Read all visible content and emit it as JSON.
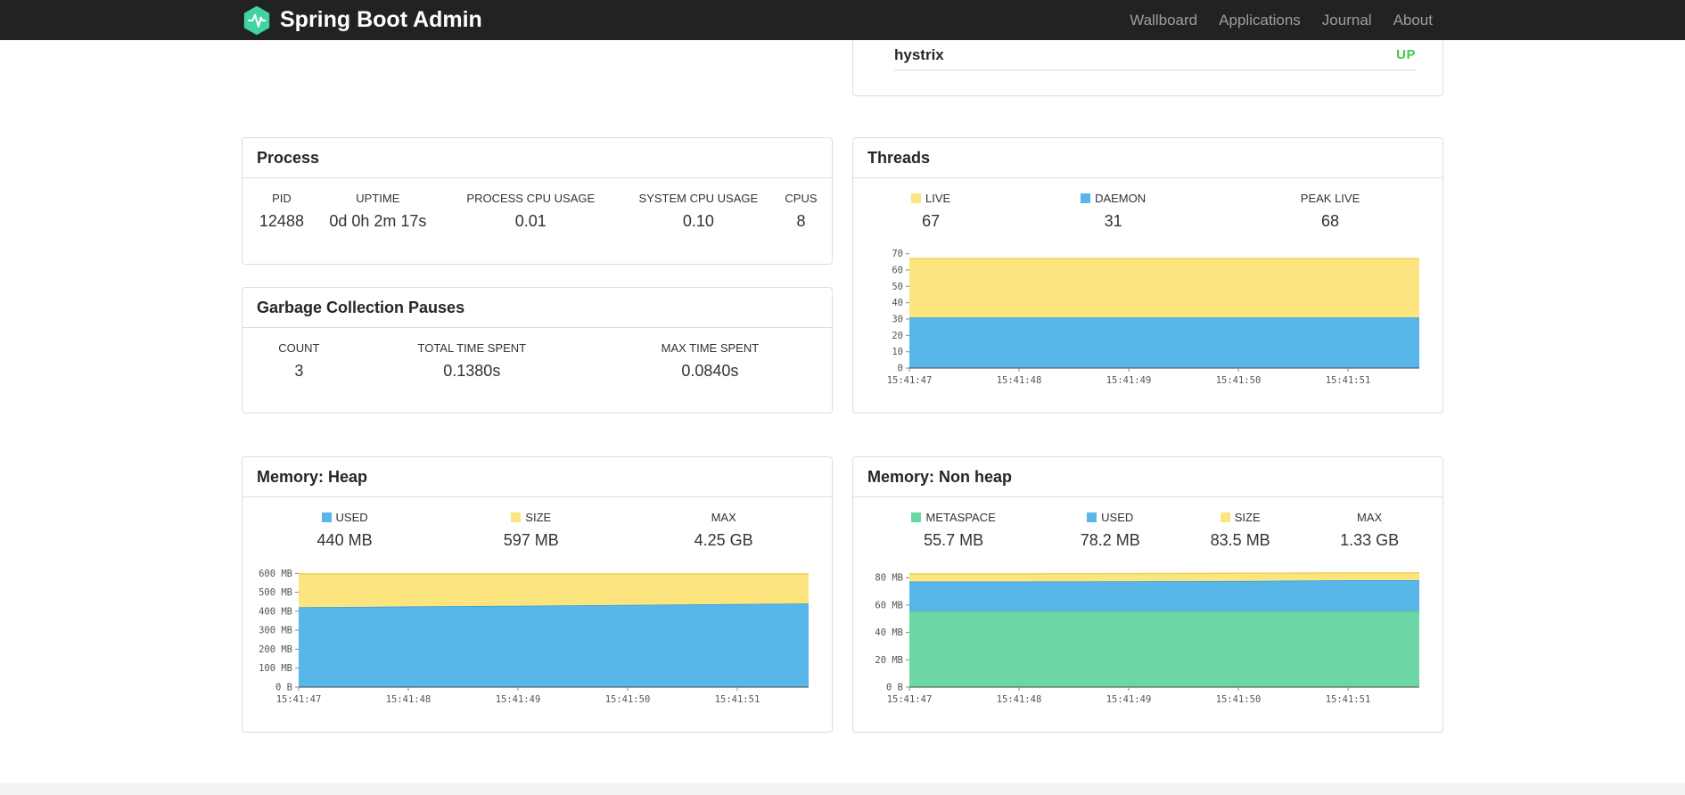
{
  "navbar": {
    "brand": "Spring Boot Admin",
    "links": [
      {
        "label": "Wallboard"
      },
      {
        "label": "Applications"
      },
      {
        "label": "Journal"
      },
      {
        "label": "About"
      }
    ]
  },
  "application_status": {
    "name": "hystrix",
    "status": "UP",
    "status_color": "#44cc44"
  },
  "colors": {
    "navbar_bg": "#222222",
    "brand_teal": "#42d3a2",
    "chart_yellow": "#fce57e",
    "chart_blue": "#58b6e9",
    "chart_green": "#6cd7a4",
    "status_up": "#44cc44",
    "panel_border": "#dddddd"
  },
  "panels": {
    "process": {
      "title": "Process",
      "stats": [
        {
          "label": "PID",
          "value": "12488"
        },
        {
          "label": "UPTIME",
          "value": "0d 0h 2m 17s"
        },
        {
          "label": "PROCESS CPU USAGE",
          "value": "0.01"
        },
        {
          "label": "SYSTEM CPU USAGE",
          "value": "0.10"
        },
        {
          "label": "CPUS",
          "value": "8"
        }
      ]
    },
    "gc": {
      "title": "Garbage Collection Pauses",
      "stats": [
        {
          "label": "COUNT",
          "value": "3"
        },
        {
          "label": "TOTAL TIME SPENT",
          "value": "0.1380s"
        },
        {
          "label": "MAX TIME SPENT",
          "value": "0.0840s"
        }
      ]
    },
    "threads": {
      "title": "Threads",
      "stats": [
        {
          "label": "LIVE",
          "value": "67",
          "legend_color": "#fce57e"
        },
        {
          "label": "DAEMON",
          "value": "31",
          "legend_color": "#58b6e9"
        },
        {
          "label": "PEAK LIVE",
          "value": "68"
        }
      ]
    },
    "heap": {
      "title": "Memory: Heap",
      "stats": [
        {
          "label": "USED",
          "value": "440 MB",
          "legend_color": "#58b6e9"
        },
        {
          "label": "SIZE",
          "value": "597 MB",
          "legend_color": "#fce57e"
        },
        {
          "label": "MAX",
          "value": "4.25 GB"
        }
      ]
    },
    "nonheap": {
      "title": "Memory: Non heap",
      "stats": [
        {
          "label": "METASPACE",
          "value": "55.7 MB",
          "legend_color": "#6cd7a4"
        },
        {
          "label": "USED",
          "value": "78.2 MB",
          "legend_color": "#58b6e9"
        },
        {
          "label": "SIZE",
          "value": "83.5 MB",
          "legend_color": "#fce57e"
        },
        {
          "label": "MAX",
          "value": "1.33 GB"
        }
      ]
    }
  },
  "chart_data": [
    {
      "type": "area",
      "title": "Threads",
      "stacking": "absolute",
      "legend_position": "above-chart",
      "grid": false,
      "x_labels": [
        "15:41:47",
        "15:41:48",
        "15:41:49",
        "15:41:50",
        "15:41:51"
      ],
      "x_units": [
        0,
        1,
        2,
        3,
        4,
        4.65
      ],
      "y_max": 72,
      "y_ticks": [
        {
          "label": "0",
          "v": 0
        },
        {
          "label": "10",
          "v": 10
        },
        {
          "label": "20",
          "v": 20
        },
        {
          "label": "30",
          "v": 30
        },
        {
          "label": "40",
          "v": 40
        },
        {
          "label": "50",
          "v": 50
        },
        {
          "label": "60",
          "v": 60
        },
        {
          "label": "70",
          "v": 70
        }
      ],
      "series": [
        {
          "name": "DAEMON",
          "fill_color": "#58b6e9",
          "line_color": "#2f9ddf",
          "values": [
            31,
            31,
            31,
            31,
            31,
            31
          ]
        },
        {
          "name": "LIVE",
          "fill_color": "#fce57e",
          "line_color": "#f0d154",
          "values": [
            67,
            67,
            67,
            67,
            67,
            67
          ]
        }
      ]
    },
    {
      "type": "area",
      "title": "Memory: Heap",
      "stacking": "absolute",
      "grid": false,
      "x_labels": [
        "15:41:47",
        "15:41:48",
        "15:41:49",
        "15:41:50",
        "15:41:51"
      ],
      "x_units": [
        0,
        1,
        2,
        3,
        4,
        4.65
      ],
      "y_max": 620,
      "y_unit": "MB",
      "y_ticks": [
        {
          "label": "0 B",
          "v": 0
        },
        {
          "label": "100 MB",
          "v": 100
        },
        {
          "label": "200 MB",
          "v": 200
        },
        {
          "label": "300 MB",
          "v": 300
        },
        {
          "label": "400 MB",
          "v": 400
        },
        {
          "label": "500 MB",
          "v": 500
        },
        {
          "label": "600 MB",
          "v": 600
        }
      ],
      "series": [
        {
          "name": "USED",
          "fill_color": "#58b6e9",
          "line_color": "#2f9ddf",
          "values": [
            421,
            425,
            429,
            433,
            438,
            441
          ]
        },
        {
          "name": "SIZE",
          "fill_color": "#fce57e",
          "line_color": "#f0d154",
          "values": [
            597,
            597,
            597,
            597,
            597,
            597
          ]
        }
      ]
    },
    {
      "type": "area",
      "title": "Memory: Non heap",
      "stacking": "absolute",
      "grid": false,
      "x_labels": [
        "15:41:47",
        "15:41:48",
        "15:41:49",
        "15:41:50",
        "15:41:51"
      ],
      "x_units": [
        0,
        1,
        2,
        3,
        4,
        4.65
      ],
      "y_max": 86,
      "y_unit": "MB",
      "y_ticks": [
        {
          "label": "0 B",
          "v": 0
        },
        {
          "label": "20 MB",
          "v": 20
        },
        {
          "label": "40 MB",
          "v": 40
        },
        {
          "label": "60 MB",
          "v": 60
        },
        {
          "label": "80 MB",
          "v": 80
        }
      ],
      "series": [
        {
          "name": "METASPACE",
          "fill_color": "#6cd7a4",
          "line_color": "#49c98d",
          "values": [
            55.7,
            55.7,
            55.7,
            55.7,
            55.7,
            55.7
          ]
        },
        {
          "name": "USED",
          "fill_color": "#58b6e9",
          "line_color": "#2f9ddf",
          "values": [
            77.2,
            77.2,
            77.4,
            77.6,
            78.2,
            78.2
          ]
        },
        {
          "name": "SIZE",
          "fill_color": "#fce57e",
          "line_color": "#f0d154",
          "values": [
            82.8,
            82.8,
            83.0,
            83.2,
            83.5,
            83.5
          ]
        }
      ]
    }
  ]
}
